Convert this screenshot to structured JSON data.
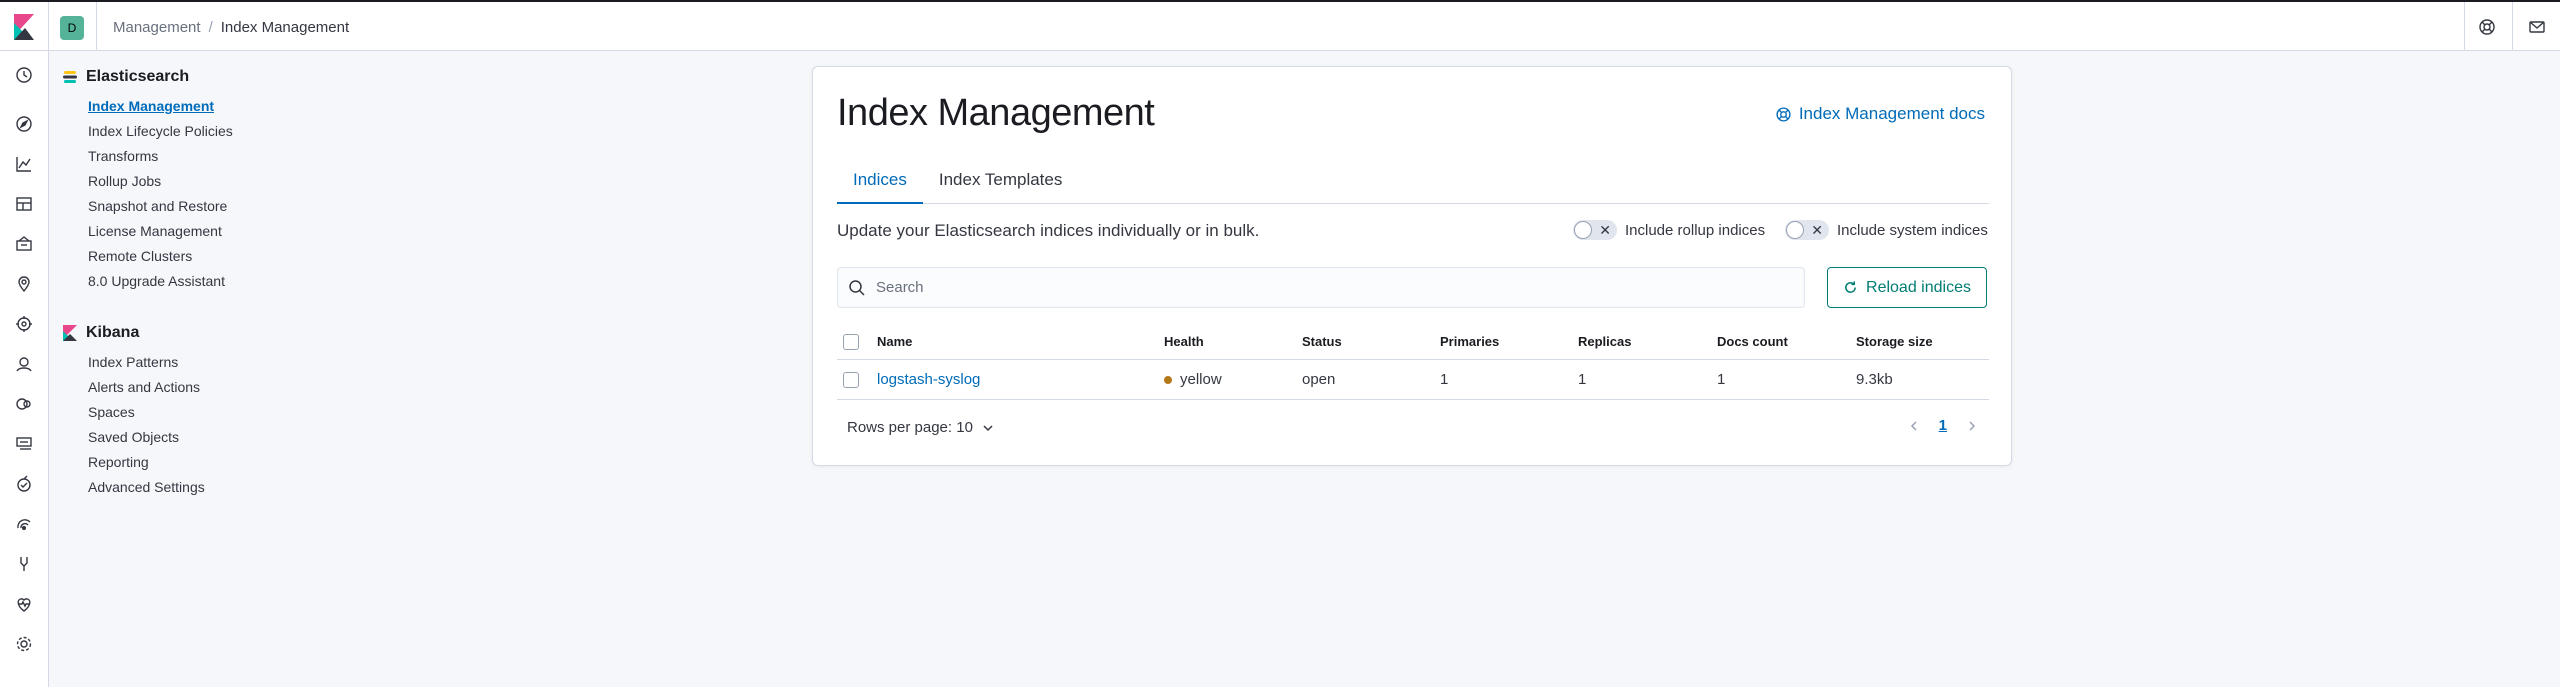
{
  "header": {
    "space_initial": "D",
    "breadcrumbs": [
      "Management",
      "Index Management"
    ]
  },
  "sidebar": {
    "sections": [
      {
        "title": "Elasticsearch",
        "items": [
          "Index Management",
          "Index Lifecycle Policies",
          "Transforms",
          "Rollup Jobs",
          "Snapshot and Restore",
          "License Management",
          "Remote Clusters",
          "8.0 Upgrade Assistant"
        ]
      },
      {
        "title": "Kibana",
        "items": [
          "Index Patterns",
          "Alerts and Actions",
          "Spaces",
          "Saved Objects",
          "Reporting",
          "Advanced Settings"
        ]
      }
    ]
  },
  "main": {
    "title": "Index Management",
    "docs_link": "Index Management docs",
    "tabs": [
      "Indices",
      "Index Templates"
    ],
    "description": "Update your Elasticsearch indices individually or in bulk.",
    "toggles": {
      "rollup": "Include rollup indices",
      "system": "Include system indices"
    },
    "search_placeholder": "Search",
    "reload_label": "Reload indices",
    "table": {
      "columns": [
        "Name",
        "Health",
        "Status",
        "Primaries",
        "Replicas",
        "Docs count",
        "Storage size"
      ],
      "rows": [
        {
          "name": "logstash-syslog",
          "health": "yellow",
          "status": "open",
          "primaries": "1",
          "replicas": "1",
          "docs_count": "1",
          "storage_size": "9.3kb"
        }
      ]
    },
    "rows_per_page": "Rows per page: 10",
    "current_page": "1"
  },
  "colors": {
    "accent": "#006bb8",
    "success": "#017d73",
    "health_yellow": "#b5781a"
  }
}
